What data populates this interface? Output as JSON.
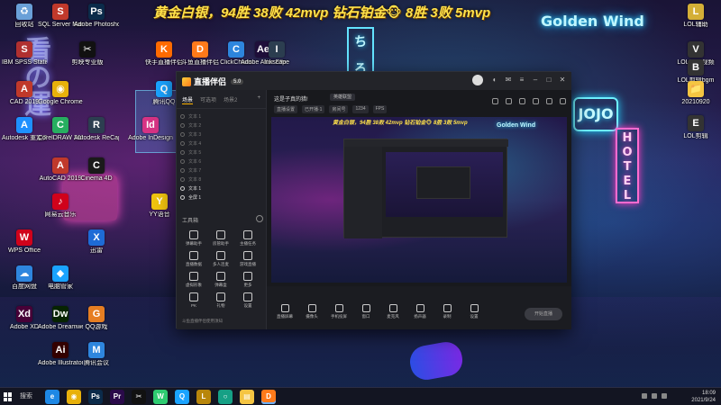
{
  "banner": "黄金白银，94胜 38败 42mvp 钻石铂金🐵 8胜 3败 5mvp",
  "desktop_icons": [
    {
      "label": "回收站",
      "icon": "recycle-bin-icon",
      "color": "#6aa0d8",
      "glyph": "♻"
    },
    {
      "label": "SQL Server Manager",
      "icon": "sql-server-icon",
      "color": "#c0392b",
      "glyph": "S"
    },
    {
      "label": "Adobe Photoshop",
      "icon": "photoshop-icon",
      "color": "#0b2b4a",
      "glyph": "Ps"
    },
    {
      "label": "IBM SPSS Statistics 21",
      "icon": "spss-icon",
      "color": "#b03030",
      "glyph": "S"
    },
    {
      "label": "剪映专业版",
      "icon": "capcut-icon",
      "color": "#111",
      "glyph": "✂"
    },
    {
      "label": "快手直播伴侣",
      "icon": "kuaishou-icon",
      "color": "#ff6a00",
      "glyph": "K"
    },
    {
      "label": "斗鱼直播伴侣",
      "icon": "douyu-icon",
      "color": "#ff7a1a",
      "glyph": "D"
    },
    {
      "label": "ClickCharts",
      "icon": "clickcharts-icon",
      "color": "#2e86de",
      "glyph": "C"
    },
    {
      "label": "Adobe After Effects CC",
      "icon": "after-effects-icon",
      "color": "#1f0f3a",
      "glyph": "Ae"
    },
    {
      "label": "Inkscape",
      "icon": "inkscape-icon",
      "color": "#2c3e50",
      "glyph": "I"
    },
    {
      "label": "CAD 2019",
      "icon": "autocad-icon",
      "color": "#c0392b",
      "glyph": "A"
    },
    {
      "label": "Google Chrome",
      "icon": "chrome-icon",
      "color": "#e8b10b",
      "glyph": "◉"
    },
    {
      "label": "Autodesk 重定向",
      "icon": "autodesk-icon",
      "color": "#1e90ff",
      "glyph": "A"
    },
    {
      "label": "CorelDRAW 2020 (64-Bit)",
      "icon": "coreldraw-icon",
      "color": "#27ae60",
      "glyph": "C"
    },
    {
      "label": "Autodesk ReCap",
      "icon": "recap-icon",
      "color": "#2c3e50",
      "glyph": "R"
    },
    {
      "label": "Adobe InDesign",
      "icon": "indesign-icon",
      "color": "#d63384",
      "glyph": "Id"
    },
    {
      "label": "AutoCAD 2019",
      "icon": "autocad2019-icon",
      "color": "#c0392b",
      "glyph": "A"
    },
    {
      "label": "Cinema 4D",
      "icon": "cinema4d-icon",
      "color": "#1a1a1a",
      "glyph": "C"
    },
    {
      "label": "腾讯QQ",
      "icon": "qq-icon",
      "color": "#1aa3ff",
      "glyph": "Q"
    },
    {
      "label": "网易云音乐",
      "icon": "netease-music-icon",
      "color": "#d0021b",
      "glyph": "♪"
    },
    {
      "label": "WPS Office",
      "icon": "wps-icon",
      "color": "#d0021b",
      "glyph": "W"
    },
    {
      "label": "百度网盘",
      "icon": "baidu-netdisk-icon",
      "color": "#2e86de",
      "glyph": "☁"
    },
    {
      "label": "电脑管家",
      "icon": "pc-manager-icon",
      "color": "#1aa3ff",
      "glyph": "◆"
    },
    {
      "label": "迅雷",
      "icon": "xunlei-icon",
      "color": "#1e6bd6",
      "glyph": "X"
    },
    {
      "label": "Adobe XD",
      "icon": "adobe-xd-icon",
      "color": "#470137",
      "glyph": "Xd"
    },
    {
      "label": "Adobe Dreamweaver",
      "icon": "dreamweaver-icon",
      "color": "#072401",
      "glyph": "Dw"
    },
    {
      "label": "QQ游戏",
      "icon": "qq-game-icon",
      "color": "#e67e22",
      "glyph": "G"
    },
    {
      "label": "Adobe Illustrator",
      "icon": "illustrator-icon",
      "color": "#330000",
      "glyph": "Ai"
    },
    {
      "label": "腾讯会议",
      "icon": "tencent-meeting-icon",
      "color": "#2e86de",
      "glyph": "M"
    },
    {
      "label": "YY语音",
      "icon": "yy-icon",
      "color": "#f1c40f",
      "glyph": "Y"
    },
    {
      "label": "LOL辅助",
      "icon": "lol-helper-icon",
      "color": "#d4af37",
      "glyph": "L"
    },
    {
      "label": "LOL剪辑视频",
      "icon": "lol-video-icon",
      "color": "#333",
      "glyph": "V"
    },
    {
      "label": "LOL剪辑bgm",
      "icon": "lol-bgm-icon",
      "color": "#333",
      "glyph": "B"
    },
    {
      "label": "20210920",
      "icon": "folder-icon",
      "color": "#f5c542",
      "glyph": "📁"
    },
    {
      "label": "LOL剪辑",
      "icon": "lol-edit-icon",
      "color": "#333",
      "glyph": "E"
    }
  ],
  "app": {
    "title": "直播伴侣",
    "version": "5.0",
    "tabs": [
      "场景",
      "可选项",
      "场景2"
    ],
    "sources": [
      {
        "name": "文本 1",
        "on": false
      },
      {
        "name": "文本 2",
        "on": false
      },
      {
        "name": "文本 3",
        "on": false
      },
      {
        "name": "文本 4",
        "on": false
      },
      {
        "name": "文本 5",
        "on": false
      },
      {
        "name": "文本 6",
        "on": false
      },
      {
        "name": "文本 7",
        "on": false
      },
      {
        "name": "文本 8",
        "on": false
      },
      {
        "name": "文本 1",
        "on": true
      },
      {
        "name": "全屏 1",
        "on": true
      }
    ],
    "tools_title": "工具箱",
    "tools": [
      {
        "label": "弹幕助手",
        "icon": "danmaku-icon"
      },
      {
        "label": "房管助手",
        "icon": "manager-icon"
      },
      {
        "label": "主播任务",
        "icon": "task-icon"
      },
      {
        "label": "直播数据",
        "icon": "stats-icon"
      },
      {
        "label": "多人连麦",
        "icon": "co-host-icon"
      },
      {
        "label": "游戏直播",
        "icon": "game-icon"
      },
      {
        "label": "虚拟形象",
        "icon": "avatar-icon"
      },
      {
        "label": "弹幕盒",
        "icon": "danmaku-box-icon"
      },
      {
        "label": "更多",
        "icon": "more-icon"
      },
      {
        "label": "PK",
        "icon": "pk-icon"
      },
      {
        "label": "礼物",
        "icon": "gift-icon"
      },
      {
        "label": "设置",
        "icon": "settings-icon"
      }
    ],
    "notice": "斗鱼直播伴侣使用须知",
    "stream_title": "这是子真的猎!",
    "category": "英雄联盟",
    "row2": [
      "直播设置",
      "已开播·1",
      "房间号",
      "1234",
      "FPS"
    ],
    "preview_banner": "黄金白银，94胜 38败 42mvp 钻石铂金🐵 8胜 3败 5mvp",
    "preview_sign": "Golden Wind",
    "bottom_buttons": [
      {
        "label": "直播屏幕",
        "icon": "screen-icon"
      },
      {
        "label": "摄像头",
        "icon": "camera-icon"
      },
      {
        "label": "手机投屏",
        "icon": "phone-cast-icon"
      },
      {
        "label": "窗口",
        "icon": "window-icon"
      },
      {
        "label": "麦克风",
        "icon": "mic-icon"
      },
      {
        "label": "扬声器",
        "icon": "speaker-icon"
      },
      {
        "label": "录制",
        "icon": "record-icon"
      },
      {
        "label": "设置",
        "icon": "gear-icon"
      }
    ],
    "live_button": "开始直播"
  },
  "taskbar": {
    "search_label": "搜索",
    "apps": [
      {
        "icon": "edge-icon",
        "color": "#1e88e5",
        "glyph": "e"
      },
      {
        "icon": "chrome-taskbar-icon",
        "color": "#e8b10b",
        "glyph": "◉"
      },
      {
        "icon": "photoshop-taskbar-icon",
        "color": "#0b2b4a",
        "glyph": "Ps"
      },
      {
        "icon": "premiere-taskbar-icon",
        "color": "#2a0a4a",
        "glyph": "Pr"
      },
      {
        "icon": "capcut-taskbar-icon",
        "color": "#111",
        "glyph": "✂"
      },
      {
        "icon": "wechat-taskbar-icon",
        "color": "#2ecc71",
        "glyph": "W"
      },
      {
        "icon": "qq-taskbar-icon",
        "color": "#1aa3ff",
        "glyph": "Q"
      },
      {
        "icon": "lol-taskbar-icon",
        "color": "#b8860b",
        "glyph": "L"
      },
      {
        "icon": "search-taskbar-icon",
        "color": "#16a085",
        "glyph": "○"
      },
      {
        "icon": "files-taskbar-icon",
        "color": "#f5c542",
        "glyph": "▤"
      },
      {
        "icon": "douyu-taskbar-icon",
        "color": "#ff7a1a",
        "glyph": "D"
      }
    ],
    "time": "18:09",
    "date": "2021/9/24"
  }
}
